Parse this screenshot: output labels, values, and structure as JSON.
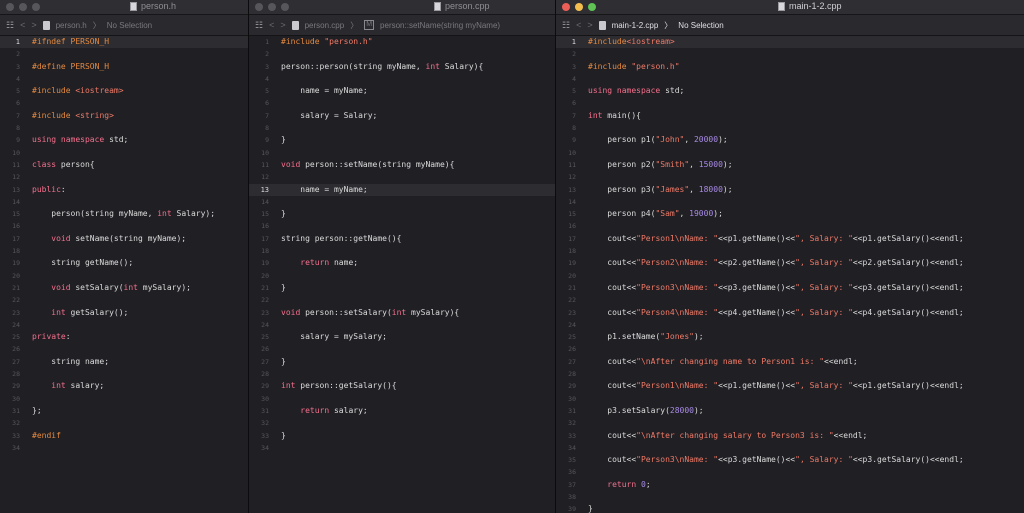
{
  "windows": [
    {
      "id": "w1",
      "title": "person.h",
      "traffic_lights_active": false,
      "jump": {
        "nav": [
          "<",
          ">"
        ],
        "file": "person.h",
        "sep": "〉",
        "selection": "No Selection"
      },
      "current_line": 0,
      "lines": [
        [
          [
            "pp",
            "#ifndef PERSON_H"
          ]
        ],
        [],
        [
          [
            "pp",
            "#define PERSON_H"
          ]
        ],
        [],
        [
          [
            "pp",
            "#include "
          ],
          [
            "str",
            "<iostream>"
          ]
        ],
        [],
        [
          [
            "pp",
            "#include "
          ],
          [
            "str",
            "<string>"
          ]
        ],
        [],
        [
          [
            "kw",
            "using namespace "
          ],
          [
            "pl",
            "std;"
          ]
        ],
        [],
        [
          [
            "kw",
            "class "
          ],
          [
            "pl",
            "person{"
          ]
        ],
        [],
        [
          [
            "kw",
            "public"
          ],
          [
            "pl",
            ":"
          ]
        ],
        [],
        [
          [
            "pl",
            "    person(string myName, "
          ],
          [
            "kw",
            "int"
          ],
          [
            "pl",
            " Salary);"
          ]
        ],
        [],
        [
          [
            "pl",
            "    "
          ],
          [
            "kw",
            "void"
          ],
          [
            "pl",
            " setName(string myName);"
          ]
        ],
        [],
        [
          [
            "pl",
            "    string getName();"
          ]
        ],
        [],
        [
          [
            "pl",
            "    "
          ],
          [
            "kw",
            "void"
          ],
          [
            "pl",
            " setSalary("
          ],
          [
            "kw",
            "int"
          ],
          [
            "pl",
            " mySalary);"
          ]
        ],
        [],
        [
          [
            "pl",
            "    "
          ],
          [
            "kw",
            "int"
          ],
          [
            "pl",
            " getSalary();"
          ]
        ],
        [],
        [
          [
            "kw",
            "private"
          ],
          [
            "pl",
            ":"
          ]
        ],
        [],
        [
          [
            "pl",
            "    string name;"
          ]
        ],
        [],
        [
          [
            "pl",
            "    "
          ],
          [
            "kw",
            "int"
          ],
          [
            "pl",
            " salary;"
          ]
        ],
        [],
        [
          [
            "pl",
            "};"
          ]
        ],
        [],
        [
          [
            "pp",
            "#endif"
          ]
        ],
        []
      ]
    },
    {
      "id": "w2",
      "title": "person.cpp",
      "traffic_lights_active": false,
      "jump": {
        "nav": [
          "<",
          ">"
        ],
        "file": "person.cpp",
        "sep": "〉",
        "method_icon": "M",
        "selection": "person::setName(string myName)"
      },
      "current_line": 12,
      "lines": [
        [
          [
            "pp",
            "#include "
          ],
          [
            "str",
            "\"person.h\""
          ]
        ],
        [],
        [
          [
            "pl",
            "person::person(string myName, "
          ],
          [
            "kw",
            "int"
          ],
          [
            "pl",
            " Salary){"
          ]
        ],
        [],
        [
          [
            "pl",
            "    name = myName;"
          ]
        ],
        [],
        [
          [
            "pl",
            "    salary = Salary;"
          ]
        ],
        [],
        [
          [
            "pl",
            "}"
          ]
        ],
        [],
        [
          [
            "kw",
            "void"
          ],
          [
            "pl",
            " person::setName(string myName){"
          ]
        ],
        [],
        [
          [
            "pl",
            "    name = myName;"
          ]
        ],
        [],
        [
          [
            "pl",
            "}"
          ]
        ],
        [],
        [
          [
            "pl",
            "string person::getName(){"
          ]
        ],
        [],
        [
          [
            "pl",
            "    "
          ],
          [
            "kw",
            "return"
          ],
          [
            "pl",
            " name;"
          ]
        ],
        [],
        [
          [
            "pl",
            "}"
          ]
        ],
        [],
        [
          [
            "kw",
            "void"
          ],
          [
            "pl",
            " person::setSalary("
          ],
          [
            "kw",
            "int"
          ],
          [
            "pl",
            " mySalary){"
          ]
        ],
        [],
        [
          [
            "pl",
            "    salary = mySalary;"
          ]
        ],
        [],
        [
          [
            "pl",
            "}"
          ]
        ],
        [],
        [
          [
            "kw",
            "int"
          ],
          [
            "pl",
            " person::getSalary(){"
          ]
        ],
        [],
        [
          [
            "pl",
            "    "
          ],
          [
            "kw",
            "return"
          ],
          [
            "pl",
            " salary;"
          ]
        ],
        [],
        [
          [
            "pl",
            "}"
          ]
        ],
        []
      ]
    },
    {
      "id": "w3",
      "title": "main-1-2.cpp",
      "traffic_lights_active": true,
      "jump": {
        "nav": [
          "<",
          ">"
        ],
        "file": "main-1-2.cpp",
        "sep": "〉",
        "selection": "No Selection"
      },
      "current_line": 0,
      "lines": [
        [
          [
            "pp",
            "#include"
          ],
          [
            "str",
            "<iostream>"
          ]
        ],
        [],
        [
          [
            "pp",
            "#include "
          ],
          [
            "str",
            "\"person.h\""
          ]
        ],
        [],
        [
          [
            "kw",
            "using namespace "
          ],
          [
            "pl",
            "std;"
          ]
        ],
        [],
        [
          [
            "kw",
            "int"
          ],
          [
            "pl",
            " main(){"
          ]
        ],
        [],
        [
          [
            "pl",
            "    person p1("
          ],
          [
            "str",
            "\"John\""
          ],
          [
            "pl",
            ", "
          ],
          [
            "num",
            "20000"
          ],
          [
            "pl",
            ");"
          ]
        ],
        [],
        [
          [
            "pl",
            "    person p2("
          ],
          [
            "str",
            "\"Smith\""
          ],
          [
            "pl",
            ", "
          ],
          [
            "num",
            "15000"
          ],
          [
            "pl",
            ");"
          ]
        ],
        [],
        [
          [
            "pl",
            "    person p3("
          ],
          [
            "str",
            "\"James\""
          ],
          [
            "pl",
            ", "
          ],
          [
            "num",
            "18000"
          ],
          [
            "pl",
            ");"
          ]
        ],
        [],
        [
          [
            "pl",
            "    person p4("
          ],
          [
            "str",
            "\"Sam\""
          ],
          [
            "pl",
            ", "
          ],
          [
            "num",
            "19000"
          ],
          [
            "pl",
            ");"
          ]
        ],
        [],
        [
          [
            "pl",
            "    cout<<"
          ],
          [
            "str",
            "\"Person1\\nName: \""
          ],
          [
            "pl",
            "<<p1.getName()<<"
          ],
          [
            "str",
            "\", Salary: \""
          ],
          [
            "pl",
            "<<p1.getSalary()<<endl;"
          ]
        ],
        [],
        [
          [
            "pl",
            "    cout<<"
          ],
          [
            "str",
            "\"Person2\\nName: \""
          ],
          [
            "pl",
            "<<p2.getName()<<"
          ],
          [
            "str",
            "\", Salary: \""
          ],
          [
            "pl",
            "<<p2.getSalary()<<endl;"
          ]
        ],
        [],
        [
          [
            "pl",
            "    cout<<"
          ],
          [
            "str",
            "\"Person3\\nName: \""
          ],
          [
            "pl",
            "<<p3.getName()<<"
          ],
          [
            "str",
            "\", Salary: \""
          ],
          [
            "pl",
            "<<p3.getSalary()<<endl;"
          ]
        ],
        [],
        [
          [
            "pl",
            "    cout<<"
          ],
          [
            "str",
            "\"Person4\\nName: \""
          ],
          [
            "pl",
            "<<p4.getName()<<"
          ],
          [
            "str",
            "\", Salary: \""
          ],
          [
            "pl",
            "<<p4.getSalary()<<endl;"
          ]
        ],
        [],
        [
          [
            "pl",
            "    p1.setName("
          ],
          [
            "str",
            "\"Jones\""
          ],
          [
            "pl",
            ");"
          ]
        ],
        [],
        [
          [
            "pl",
            "    cout<<"
          ],
          [
            "str",
            "\"\\nAfter changing name to Person1 is: \""
          ],
          [
            "pl",
            "<<endl;"
          ]
        ],
        [],
        [
          [
            "pl",
            "    cout<<"
          ],
          [
            "str",
            "\"Person1\\nName: \""
          ],
          [
            "pl",
            "<<p1.getName()<<"
          ],
          [
            "str",
            "\", Salary: \""
          ],
          [
            "pl",
            "<<p1.getSalary()<<endl;"
          ]
        ],
        [],
        [
          [
            "pl",
            "    p3.setSalary("
          ],
          [
            "num",
            "28000"
          ],
          [
            "pl",
            ");"
          ]
        ],
        [],
        [
          [
            "pl",
            "    cout<<"
          ],
          [
            "str",
            "\"\\nAfter changing salary to Person3 is: \""
          ],
          [
            "pl",
            "<<endl;"
          ]
        ],
        [],
        [
          [
            "pl",
            "    cout<<"
          ],
          [
            "str",
            "\"Person3\\nName: \""
          ],
          [
            "pl",
            "<<p3.getName()<<"
          ],
          [
            "str",
            "\", Salary: \""
          ],
          [
            "pl",
            "<<p3.getSalary()<<endl;"
          ]
        ],
        [],
        [
          [
            "pl",
            "    "
          ],
          [
            "kw",
            "return"
          ],
          [
            "pl",
            " "
          ],
          [
            "num",
            "0"
          ],
          [
            "pl",
            ";"
          ]
        ],
        [],
        [
          [
            "pl",
            "}"
          ]
        ]
      ]
    }
  ]
}
